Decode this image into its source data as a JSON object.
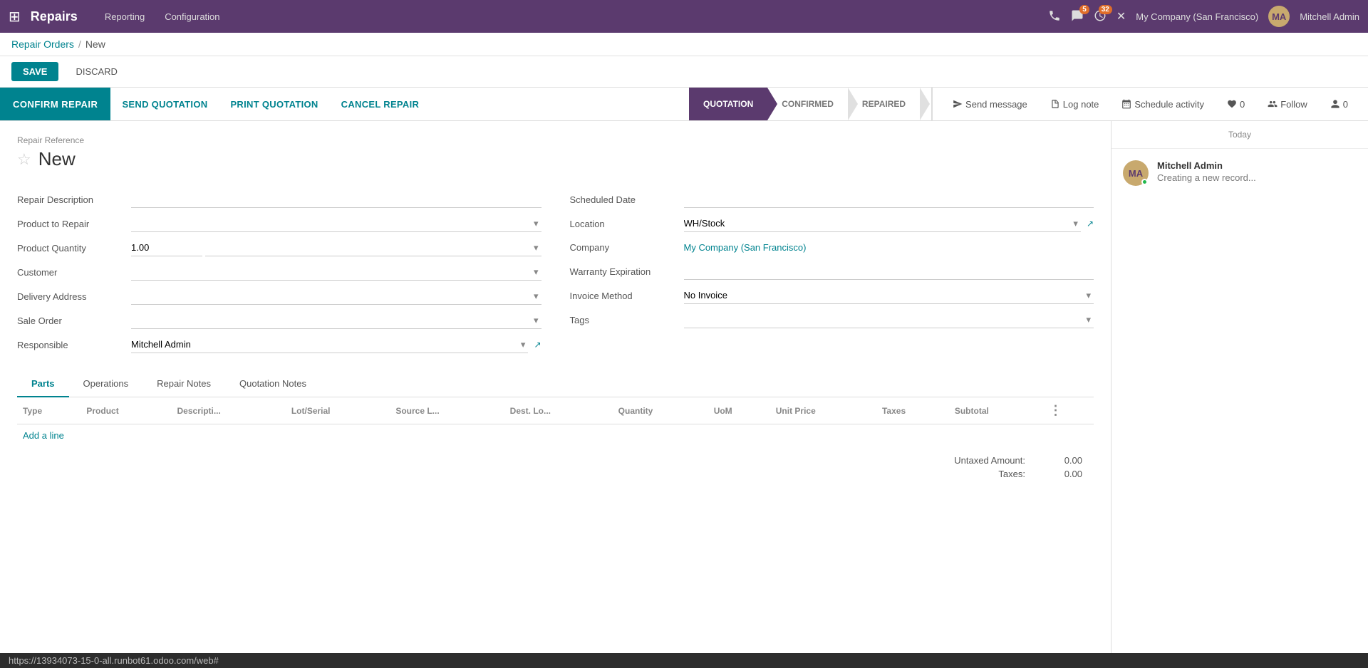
{
  "app": {
    "title": "Repairs",
    "grid_icon": "⊞"
  },
  "top_nav": {
    "links": [
      "Reporting",
      "Configuration"
    ],
    "icons": {
      "phone": "📞",
      "messages_badge": "5",
      "clock_badge": "32",
      "close": "✕"
    },
    "company": "My Company (San Francisco)",
    "user": {
      "name": "Mitchell Admin",
      "initials": "MA"
    }
  },
  "breadcrumb": {
    "parent": "Repair Orders",
    "separator": "/",
    "current": "New"
  },
  "actions": {
    "save": "SAVE",
    "discard": "DISCARD"
  },
  "workflow_buttons": {
    "confirm_repair": "CONFIRM REPAIR",
    "send_quotation": "SEND QUOTATION",
    "print_quotation": "PRINT QUOTATION",
    "cancel_repair": "CANCEL REPAIR"
  },
  "status_steps": [
    {
      "id": "quotation",
      "label": "QUOTATION",
      "active": true
    },
    {
      "id": "confirmed",
      "label": "CONFIRMED",
      "active": false
    },
    {
      "id": "repaired",
      "label": "REPAIRED",
      "active": false
    }
  ],
  "chatter_actions": {
    "send_message": "Send message",
    "log_note": "Log note",
    "schedule_activity": "Schedule activity",
    "followers_count": "0",
    "like_count": "0",
    "follow": "Follow"
  },
  "form": {
    "repair_ref_label": "Repair Reference",
    "repair_name": "New",
    "left_fields": [
      {
        "label": "Repair Description",
        "value": "",
        "type": "input"
      },
      {
        "label": "Product to Repair",
        "value": "",
        "type": "select"
      },
      {
        "label": "Product Quantity",
        "value": "1.00",
        "type": "input_select"
      },
      {
        "label": "Customer",
        "value": "",
        "type": "select"
      },
      {
        "label": "Delivery Address",
        "value": "",
        "type": "select"
      },
      {
        "label": "Sale Order",
        "value": "",
        "type": "select"
      },
      {
        "label": "Responsible",
        "value": "Mitchell Admin",
        "type": "select_link"
      }
    ],
    "right_fields": [
      {
        "label": "Scheduled Date",
        "value": "",
        "type": "input"
      },
      {
        "label": "Location",
        "value": "WH/Stock",
        "type": "select_link"
      },
      {
        "label": "Company",
        "value": "My Company (San Francisco)",
        "type": "link"
      },
      {
        "label": "Warranty Expiration",
        "value": "",
        "type": "input"
      },
      {
        "label": "Invoice Method",
        "value": "No Invoice",
        "type": "select"
      },
      {
        "label": "Tags",
        "value": "",
        "type": "select"
      }
    ]
  },
  "tabs": [
    {
      "id": "parts",
      "label": "Parts",
      "active": true
    },
    {
      "id": "operations",
      "label": "Operations",
      "active": false
    },
    {
      "id": "repair_notes",
      "label": "Repair Notes",
      "active": false
    },
    {
      "id": "quotation_notes",
      "label": "Quotation Notes",
      "active": false
    }
  ],
  "table": {
    "columns": [
      "Type",
      "Product",
      "Descripti...",
      "Lot/Serial",
      "Source L...",
      "Dest. Lo...",
      "Quantity",
      "UoM",
      "Unit Price",
      "Taxes",
      "Subtotal"
    ],
    "rows": [],
    "add_line": "Add a line"
  },
  "totals": {
    "untaxed_label": "Untaxed Amount:",
    "untaxed_value": "0.00",
    "taxes_label": "Taxes:",
    "taxes_value": "0.00"
  },
  "chatter": {
    "today_label": "Today",
    "message": {
      "author": "Mitchell Admin",
      "initials": "MA",
      "text": "Creating a new record..."
    }
  },
  "status_bar": {
    "url": "https://13934073-15-0-all.runbot61.odoo.com/web#"
  }
}
